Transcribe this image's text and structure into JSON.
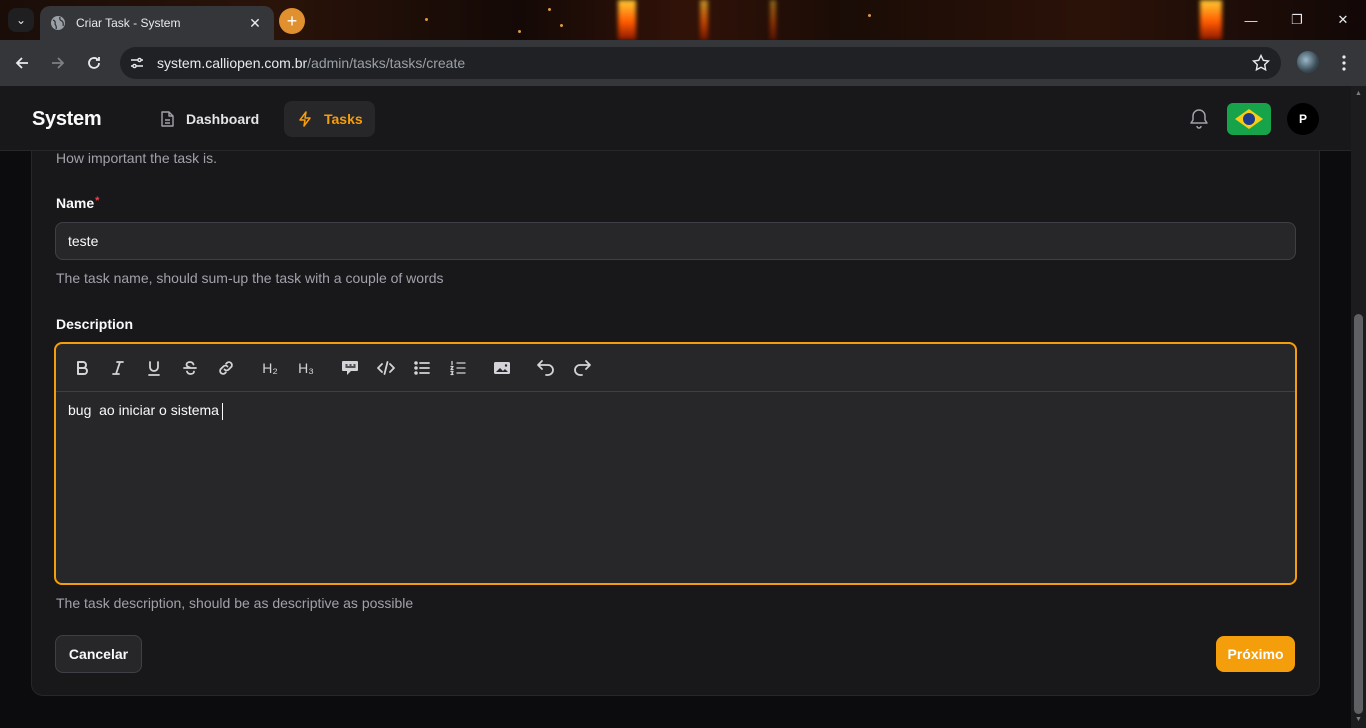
{
  "browser": {
    "tab_title": "Criar Task - System",
    "tab_close": "✕",
    "new_tab": "+",
    "tab_menu": "⌄",
    "window_controls": {
      "minimize": "—",
      "restore": "❐",
      "close": "✕"
    },
    "url_host": "system.calliopen.com.br",
    "url_path": "/admin/tasks/tasks/create"
  },
  "app": {
    "brand": "System",
    "nav": [
      {
        "label": "Dashboard",
        "icon": "document-icon"
      },
      {
        "label": "Tasks",
        "icon": "bolt-icon",
        "active": true
      }
    ],
    "accent_color": "#f59e0b",
    "language_flag": "brazil-flag",
    "avatar_initial": "P"
  },
  "form": {
    "priority_helper": "How important the task is.",
    "name": {
      "label": "Name",
      "required_mark": "*",
      "value": "teste",
      "helper": "The task name, should sum-up the task with a couple of words"
    },
    "description": {
      "label": "Description",
      "value": "bug  ao iniciar o sistema",
      "helper": "The task description, should be as descriptive as possible",
      "toolbar": {
        "h2": "H₂",
        "h3": "H₃",
        "tools": [
          "bold-icon",
          "italic-icon",
          "underline-icon",
          "strikethrough-icon",
          "link-icon",
          "heading-2-icon",
          "heading-3-icon",
          "blockquote-icon",
          "code-icon",
          "bullet-list-icon",
          "ordered-list-icon",
          "image-icon",
          "undo-icon",
          "redo-icon"
        ]
      }
    },
    "cancel_label": "Cancelar",
    "next_label": "Próximo"
  }
}
